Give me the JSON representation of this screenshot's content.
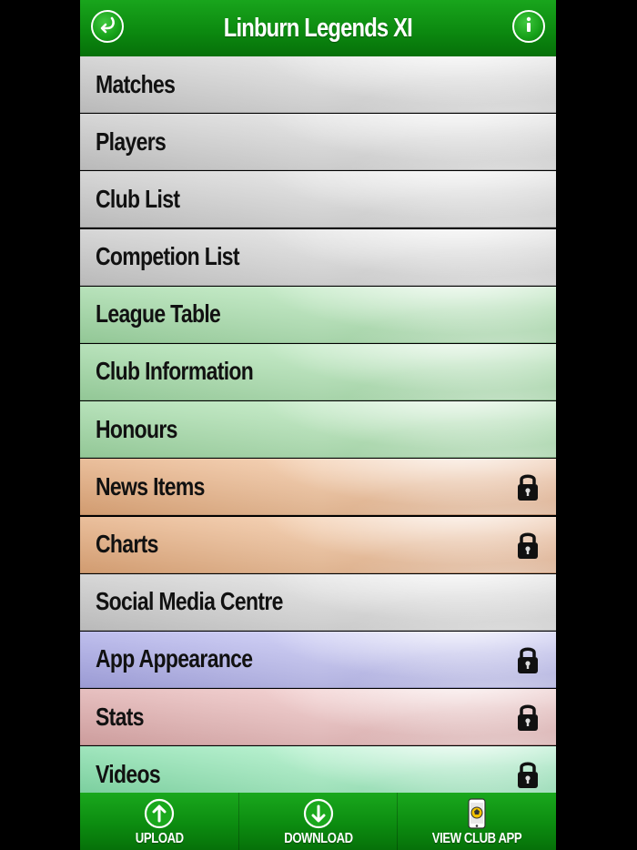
{
  "header": {
    "title": "Linburn Legends XI",
    "back_icon": "back-arrow-icon",
    "info_icon": "info-icon"
  },
  "colors": {
    "header_green": "#0c8a10",
    "grey": "#d4d4d4",
    "green": "#aee0b1",
    "orange": "#ecb88e",
    "purple": "#b8b8ee",
    "pink": "#e8bbbb",
    "teal": "#95e6b6"
  },
  "menu": {
    "items": [
      {
        "label": "Matches",
        "color": "grey",
        "locked": false
      },
      {
        "label": "Players",
        "color": "grey",
        "locked": false
      },
      {
        "label": "Club List",
        "color": "grey",
        "locked": false
      },
      {
        "label": "Competion List",
        "color": "grey",
        "locked": false
      },
      {
        "label": "League Table",
        "color": "green",
        "locked": false
      },
      {
        "label": "Club Information",
        "color": "green",
        "locked": false
      },
      {
        "label": "Honours",
        "color": "green",
        "locked": false
      },
      {
        "label": "News Items",
        "color": "orange",
        "locked": true
      },
      {
        "label": "Charts",
        "color": "orange",
        "locked": true
      },
      {
        "label": "Social Media Centre",
        "color": "grey",
        "locked": false
      },
      {
        "label": "App Appearance",
        "color": "purple",
        "locked": true
      },
      {
        "label": "Stats",
        "color": "pink",
        "locked": true
      },
      {
        "label": "Videos",
        "color": "teal",
        "locked": true
      }
    ]
  },
  "footer": {
    "upload_label": "UPLOAD",
    "download_label": "DOWNLOAD",
    "view_label": "VIEW CLUB APP"
  }
}
